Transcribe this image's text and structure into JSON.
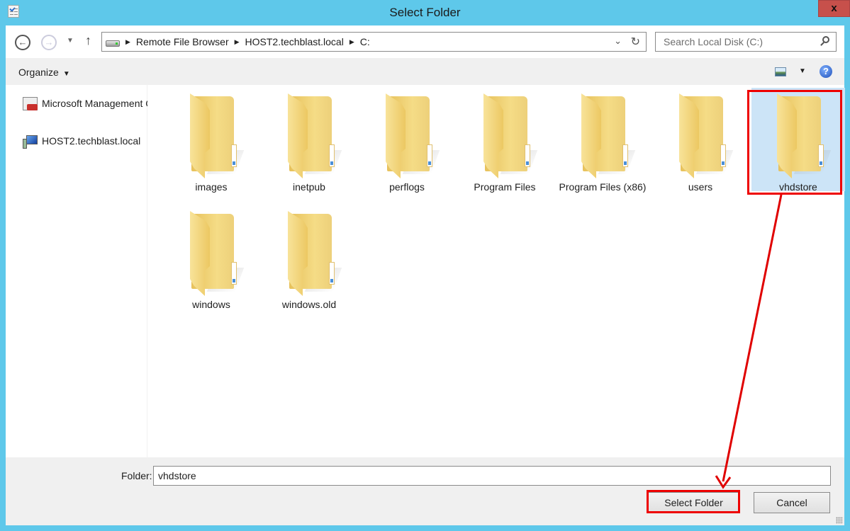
{
  "window": {
    "title": "Select Folder",
    "close_label": "x"
  },
  "navigation": {
    "back_icon": "back-arrow-icon",
    "forward_icon": "forward-arrow-icon",
    "up_icon": "up-arrow-icon",
    "breadcrumbs": [
      "Remote File Browser",
      "HOST2.techblast.local",
      "C:"
    ],
    "search_placeholder": "Search Local Disk (C:)"
  },
  "toolbar": {
    "organize_label": "Organize",
    "help_label": "?"
  },
  "sidebar": {
    "items": [
      {
        "label": "Microsoft Management Console",
        "icon": "mmc-icon"
      },
      {
        "label": "HOST2.techblast.local",
        "icon": "computer-icon"
      }
    ]
  },
  "folders": [
    {
      "name": "images",
      "selected": false
    },
    {
      "name": "inetpub",
      "selected": false
    },
    {
      "name": "perflogs",
      "selected": false
    },
    {
      "name": "Program Files",
      "selected": false
    },
    {
      "name": "Program Files (x86)",
      "selected": false
    },
    {
      "name": "users",
      "selected": false
    },
    {
      "name": "vhdstore",
      "selected": true
    },
    {
      "name": "windows",
      "selected": false
    },
    {
      "name": "windows.old",
      "selected": false
    }
  ],
  "footer": {
    "folder_label": "Folder:",
    "folder_value": "vhdstore",
    "select_button": "Select Folder",
    "cancel_button": "Cancel"
  },
  "annotation": {
    "color": "#e00000"
  }
}
